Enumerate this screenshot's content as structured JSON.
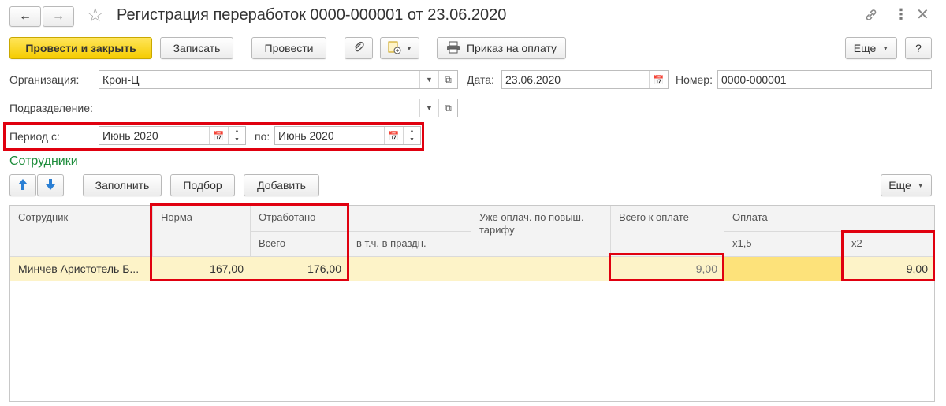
{
  "window": {
    "title": "Регистрация переработок 0000-000001 от 23.06.2020"
  },
  "toolbar": {
    "post_close": "Провести и закрыть",
    "write": "Записать",
    "post": "Провести",
    "payment_order": "Приказ на оплату",
    "more": "Еще",
    "help": "?"
  },
  "form": {
    "org_label": "Организация:",
    "org_value": "Крон-Ц",
    "date_label": "Дата:",
    "date_value": "23.06.2020",
    "number_label": "Номер:",
    "number_value": "0000-000001",
    "dept_label": "Подразделение:",
    "dept_value": "",
    "period_from_label": "Период с:",
    "period_from_value": "Июнь 2020",
    "period_to_label": "по:",
    "period_to_value": "Июнь 2020"
  },
  "employees": {
    "section_title": "Сотрудники",
    "fill": "Заполнить",
    "select": "Подбор",
    "add": "Добавить",
    "more": "Еще"
  },
  "table": {
    "headers": {
      "employee": "Сотрудник",
      "norm": "Норма",
      "worked": "Отработано",
      "worked_total": "Всего",
      "incl_holidays": "в т.ч. в праздн.",
      "already_paid": "Уже оплач. по повыш. тарифу",
      "total_to_pay": "Всего к оплате",
      "payment": "Оплата",
      "x15": "x1,5",
      "x2": "x2"
    },
    "rows": [
      {
        "employee": "Минчев Аристотель Б...",
        "norm": "167,00",
        "worked_total": "176,00",
        "incl_holidays": "",
        "already_paid": "",
        "total_to_pay": "9,00",
        "x15": "",
        "x2": "9,00"
      }
    ]
  },
  "icons": [
    "back-arrow-icon",
    "forward-arrow-icon",
    "star-icon",
    "link-icon",
    "kebab-menu-icon",
    "close-icon",
    "paperclip-icon",
    "document-create-icon",
    "printer-icon",
    "calendar-icon",
    "chevron-down-icon",
    "open-icon",
    "arrow-up-icon",
    "arrow-down-icon"
  ],
  "colors": {
    "primary": "#f5cc00",
    "section": "#1c8c3a",
    "highlight": "#e0000f",
    "selected_row": "#fdf3c8"
  }
}
